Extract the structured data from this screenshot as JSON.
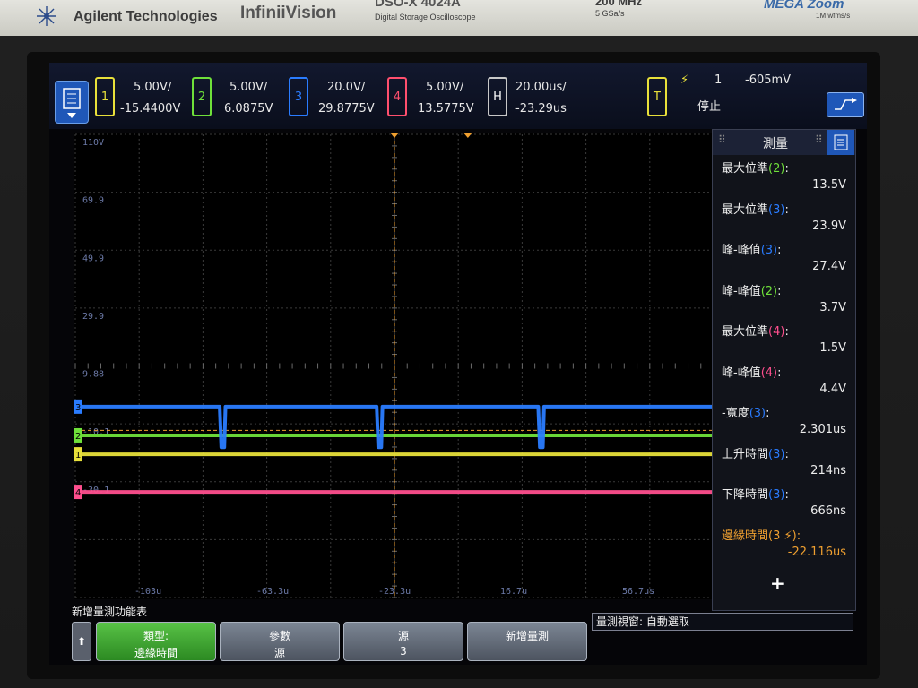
{
  "brand": {
    "company": "Agilent Technologies",
    "product_line": "InfiniiVision",
    "model": "DSO-X 4024A",
    "model_sub": "Digital Storage Oscilloscope",
    "bandwidth": "200 MHz",
    "sample_rate": "5 GSa/s",
    "memory_logo": "MEGA Zoom",
    "memory_sub": "1M wfms/s"
  },
  "channels": [
    {
      "num": "1",
      "scale": "5.00V/",
      "offset": "-15.4400V",
      "color": "#e8e03a"
    },
    {
      "num": "2",
      "scale": "5.00V/",
      "offset": "6.0875V",
      "color": "#6fe03a"
    },
    {
      "num": "3",
      "scale": "20.0V/",
      "offset": "29.8775V",
      "color": "#2a7cff"
    },
    {
      "num": "4",
      "scale": "5.00V/",
      "offset": "13.5775V",
      "color": "#ff4f8e"
    }
  ],
  "horizontal": {
    "label": "H",
    "scale": "20.00us/",
    "position": "-23.29us"
  },
  "trigger": {
    "label": "T",
    "edge_symbol": "⚡",
    "source": "1",
    "level": "-605mV",
    "status": "停止"
  },
  "sidebar": {
    "title": "測量",
    "measurements": [
      {
        "name": "最大位準",
        "ch": "2",
        "ch_color": "#6fe03a",
        "value": "13.5V"
      },
      {
        "name": "最大位準",
        "ch": "3",
        "ch_color": "#2a7cff",
        "value": "23.9V"
      },
      {
        "name": "峰-峰值",
        "ch": "3",
        "ch_color": "#2a7cff",
        "value": "27.4V"
      },
      {
        "name": "峰-峰值",
        "ch": "2",
        "ch_color": "#6fe03a",
        "value": "3.7V"
      },
      {
        "name": "最大位準",
        "ch": "4",
        "ch_color": "#ff4f8e",
        "value": "1.5V"
      },
      {
        "name": "峰-峰值",
        "ch": "4",
        "ch_color": "#ff4f8e",
        "value": "4.4V"
      },
      {
        "name": "-寬度",
        "ch": "3",
        "ch_color": "#2a7cff",
        "value": "2.301us"
      },
      {
        "name": "上升時間",
        "ch": "3",
        "ch_color": "#2a7cff",
        "value": "214ns"
      },
      {
        "name": "下降時間",
        "ch": "3",
        "ch_color": "#2a7cff",
        "value": "666ns"
      },
      {
        "name": "邊緣時間",
        "ch": "3 ⚡",
        "ch_color": "#f0a030",
        "value": "-22.116us",
        "highlight": true
      }
    ],
    "add_symbol": "+"
  },
  "softkeys": {
    "menu_title": "新增量測功能表",
    "status": "量測視窗: 自動選取",
    "keys": [
      {
        "l1": "類型:",
        "l2": "邊緣時間",
        "active": true
      },
      {
        "l1": "參數",
        "l2": "源",
        "active": false
      },
      {
        "l1": "源",
        "l2": "3",
        "active": false
      },
      {
        "l1": "新增量測",
        "l2": "",
        "active": false
      }
    ]
  },
  "chart_data": {
    "type": "line",
    "x_tick_labels": [
      "-103u",
      "-63.3u",
      "-23.3u",
      "16.7u",
      "56.7us"
    ],
    "y_tick_labels": [
      "110V",
      "69.9",
      "49.9",
      "29.9",
      "9.88",
      "-10.1",
      "-30.1"
    ],
    "xlim": [
      -183.29,
      136.71
    ],
    "ylim": [
      -49.8,
      109.8
    ],
    "grid": true,
    "series": [
      {
        "name": "1",
        "color": "#e8e03a",
        "x": [
          -183.29,
          136.71
        ],
        "y": [
          -0.44,
          -0.44
        ]
      },
      {
        "name": "2",
        "color": "#6fe03a",
        "x": [
          -183.29,
          136.71
        ],
        "y": [
          6.0875,
          6.0875
        ]
      },
      {
        "name": "3",
        "color": "#2a7cff",
        "x": [
          -180,
          -110.9,
          -110.1,
          -108.6,
          -108,
          -32.2,
          -31.4,
          -29.9,
          -29.3,
          48.8,
          49.6,
          51.1,
          51.7,
          136.71
        ],
        "y": [
          16.0,
          16.0,
          2.0,
          2.0,
          16.0,
          16.0,
          2.0,
          2.0,
          16.0,
          16.0,
          2.0,
          2.0,
          16.0,
          16.0
        ]
      },
      {
        "name": "4",
        "color": "#ff4f8e",
        "x": [
          -183.29,
          136.71
        ],
        "y": [
          -13.4,
          -13.4
        ]
      }
    ]
  }
}
